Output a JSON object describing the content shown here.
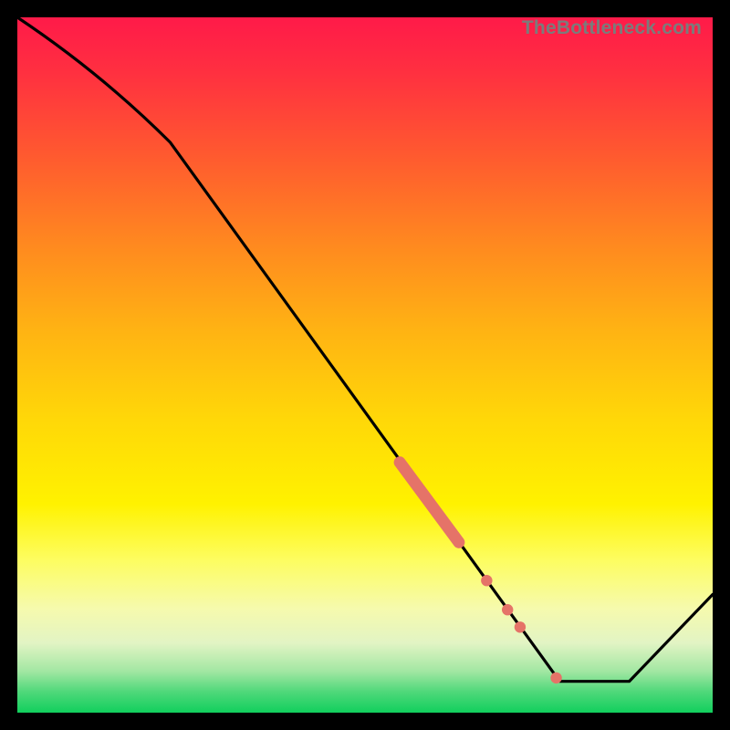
{
  "watermark": "TheBottleneck.com",
  "chart_data": {
    "type": "line",
    "title": "",
    "xlabel": "",
    "ylabel": "",
    "xlim": [
      0,
      100
    ],
    "ylim": [
      0,
      100
    ],
    "series": [
      {
        "name": "curve",
        "color": "#000000",
        "points": [
          {
            "x": 0,
            "y": 100
          },
          {
            "x": 22,
            "y": 82
          },
          {
            "x": 78,
            "y": 4.5
          },
          {
            "x": 88,
            "y": 4.5
          },
          {
            "x": 100,
            "y": 17
          }
        ]
      }
    ],
    "markers": {
      "color": "#e57368",
      "thick_segment": {
        "x1": 55.0,
        "y1": 36.0,
        "x2": 63.5,
        "y2": 24.5
      },
      "dots": [
        {
          "x": 67.5,
          "y": 19.0
        },
        {
          "x": 70.5,
          "y": 14.8
        },
        {
          "x": 72.3,
          "y": 12.3
        },
        {
          "x": 77.5,
          "y": 5.0
        }
      ]
    }
  }
}
